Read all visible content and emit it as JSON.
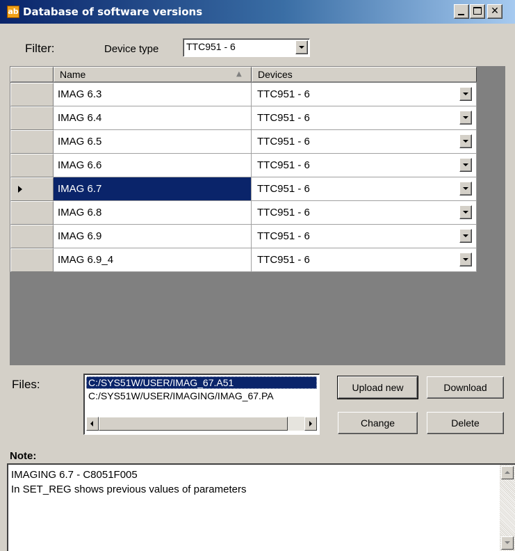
{
  "window": {
    "title": "Database of software versions",
    "icon_text": "ab",
    "min_icon": "minimize-icon",
    "max_icon": "maximize-icon",
    "close_icon": "close-icon",
    "close_glyph": "✕"
  },
  "filter": {
    "label": "Filter:",
    "device_type_label": "Device type",
    "device_type_value": "TTC951 - 6"
  },
  "grid": {
    "columns": [
      "Name",
      "Devices"
    ],
    "sort_indicator": "▲",
    "selected_row": 4,
    "rows": [
      {
        "name": "IMAG 6.3",
        "device": "TTC951 - 6"
      },
      {
        "name": "IMAG 6.4",
        "device": "TTC951 - 6"
      },
      {
        "name": "IMAG 6.5",
        "device": "TTC951 - 6"
      },
      {
        "name": "IMAG 6.6",
        "device": "TTC951 - 6"
      },
      {
        "name": "IMAG 6.7",
        "device": "TTC951 - 6"
      },
      {
        "name": "IMAG 6.8",
        "device": "TTC951 - 6"
      },
      {
        "name": "IMAG 6.9",
        "device": "TTC951 - 6"
      },
      {
        "name": "IMAG 6.9_4",
        "device": "TTC951 - 6"
      }
    ]
  },
  "files": {
    "label": "Files:",
    "items": [
      "C:/SYS51W/USER/IMAG_67.A51",
      "C:/SYS51W/USER/IMAGING/IMAG_67.PA"
    ],
    "selected_index": 0
  },
  "buttons": {
    "upload_new": "Upload new",
    "download": "Download",
    "change": "Change",
    "delete": "Delete"
  },
  "note": {
    "label": "Note:",
    "lines": [
      "IMAGING 6.7 -  C8051F005",
      "In SET_REG shows previous values of parameters"
    ]
  },
  "colors": {
    "selection": "#0a246a",
    "face": "#d4d0c8",
    "grid_background": "#808080"
  }
}
